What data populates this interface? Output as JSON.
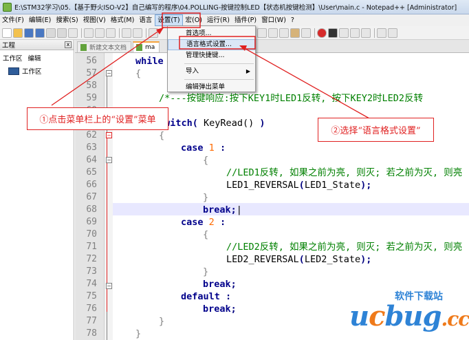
{
  "window": {
    "title": "E:\\STM32学习\\05.【基于野火ISO-V2】自己编写的程序\\04.POLLING-按键控制LED【状态机按键检测】\\User\\main.c - Notepad++ [Administrator]"
  },
  "menubar": {
    "items": [
      "文件(F)",
      "编辑(E)",
      "搜索(S)",
      "视图(V)",
      "格式(M)",
      "语言",
      "设置(T)",
      "宏(O)",
      "运行(R)",
      "插件(P)",
      "窗口(W)",
      "?"
    ]
  },
  "settings_menu": {
    "items": [
      "首选项...",
      "语言格式设置...",
      "管理快捷键...",
      "导入",
      "编辑弹出菜单"
    ]
  },
  "left_panel": {
    "title": "工程",
    "close": "x",
    "menu": [
      "工作区",
      "编辑"
    ],
    "tree_item": "工作区"
  },
  "tabs": [
    {
      "label": "新建文本文档"
    },
    {
      "label": "ma"
    }
  ],
  "editor": {
    "line_numbers": [
      "56",
      "57",
      "58",
      "59",
      "60",
      "61",
      "62",
      "63",
      "64",
      "65",
      "66",
      "67",
      "68",
      "69",
      "70",
      "71",
      "72",
      "73",
      "74",
      "75",
      "76",
      "77",
      "78"
    ]
  },
  "annotations": {
    "step1": "①点击菜单栏上的“设置”菜单",
    "step2": "②选择“语言格式设置”"
  },
  "watermark": {
    "site": "软件下载站",
    "logo": "ucbug",
    "tld": ".cc"
  },
  "colors": {
    "annotation_red": "#e02020",
    "keyword_blue": "#00008b",
    "comment_green": "#008000",
    "number_orange": "#ff6a00",
    "menu_highlight": "#dbe7f6"
  }
}
